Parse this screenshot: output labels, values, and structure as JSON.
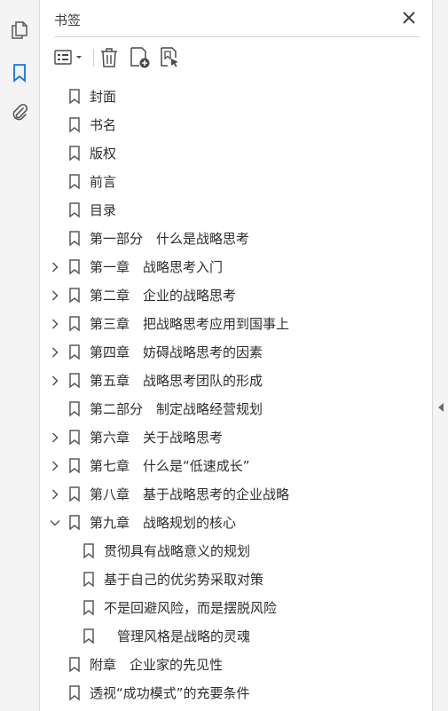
{
  "panel": {
    "title": "书签"
  },
  "sidebar": {
    "items": [
      {
        "name": "pages-thumbnails",
        "icon": "pages-icon"
      },
      {
        "name": "bookmarks",
        "icon": "bookmark-icon",
        "active": true
      },
      {
        "name": "attachments",
        "icon": "paperclip-icon"
      }
    ]
  },
  "toolbar": {
    "options_icon": "list-options-icon",
    "delete_icon": "trash-icon",
    "add_bookmark_icon": "new-bookmark-icon",
    "find_bookmark_icon": "find-bookmark-icon"
  },
  "bookmarks": [
    {
      "label": "封面",
      "level": 0,
      "expander": "none"
    },
    {
      "label": "书名",
      "level": 0,
      "expander": "none"
    },
    {
      "label": "版权",
      "level": 0,
      "expander": "none"
    },
    {
      "label": "前言",
      "level": 0,
      "expander": "none"
    },
    {
      "label": "目录",
      "level": 0,
      "expander": "none"
    },
    {
      "label": "第一部分　什么是战略思考",
      "level": 0,
      "expander": "none"
    },
    {
      "label": "第一章　战略思考入门",
      "level": 0,
      "expander": "collapsed"
    },
    {
      "label": "第二章　企业的战略思考",
      "level": 0,
      "expander": "collapsed"
    },
    {
      "label": "第三章　把战略思考应用到国事上",
      "level": 0,
      "expander": "collapsed"
    },
    {
      "label": "第四章　妨碍战略思考的因素",
      "level": 0,
      "expander": "collapsed"
    },
    {
      "label": "第五章　战略思考团队的形成",
      "level": 0,
      "expander": "collapsed"
    },
    {
      "label": "第二部分　制定战略经营规划",
      "level": 0,
      "expander": "none"
    },
    {
      "label": "第六章　关于战略思考",
      "level": 0,
      "expander": "collapsed"
    },
    {
      "label": "第七章　什么是“低速成长”",
      "level": 0,
      "expander": "collapsed"
    },
    {
      "label": "第八章　基于战略思考的企业战略",
      "level": 0,
      "expander": "collapsed"
    },
    {
      "label": "第九章　战略规划的核心",
      "level": 0,
      "expander": "expanded"
    },
    {
      "label": "贯彻具有战略意义的规划",
      "level": 1,
      "expander": "none"
    },
    {
      "label": "基于自己的优劣势采取对策",
      "level": 1,
      "expander": "none"
    },
    {
      "label": "不是回避风险，而是摆脱风险",
      "level": 1,
      "expander": "none"
    },
    {
      "label": "　管理风格是战略的灵魂",
      "level": 1,
      "expander": "none"
    },
    {
      "label": "附章　企业家的先见性",
      "level": 0,
      "expander": "none"
    },
    {
      "label": "透视“成功模式”的充要条件",
      "level": 0,
      "expander": "none"
    }
  ],
  "colors": {
    "accent": "#1473e6",
    "icon": "#5a5a5a",
    "rail": "#f4f4f4"
  }
}
